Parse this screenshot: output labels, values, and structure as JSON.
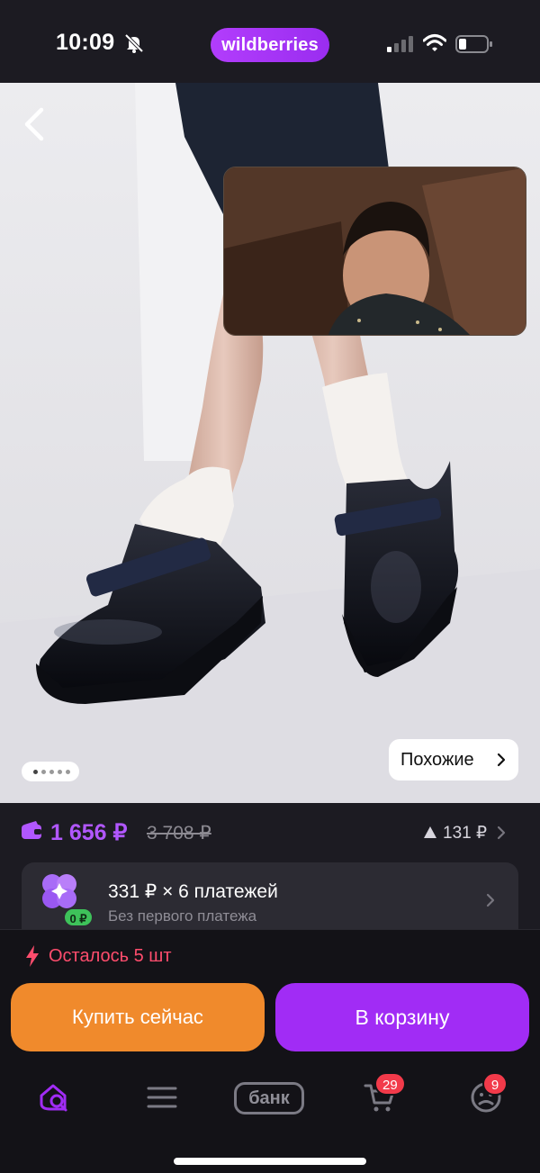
{
  "status_bar": {
    "time": "10:09",
    "brand": "wildberries"
  },
  "product_photo": {
    "gallery_dots": 5,
    "active_dot": 1,
    "similar_label": "Похожие"
  },
  "price": {
    "current": "1 656 ₽",
    "old": "3 708 ₽",
    "delta": "131 ₽"
  },
  "installment": {
    "title": "331 ₽ × 6 платежей",
    "subtitle": "Без первого платежа",
    "badge": "0 ₽"
  },
  "stock": {
    "text": "Осталось 5 шт"
  },
  "actions": {
    "buy_now": "Купить сейчас",
    "add_to_cart": "В корзину"
  },
  "tabbar": {
    "bank_label": "банк",
    "cart_badge": "29",
    "profile_badge": "9",
    "active_tab": "home",
    "colors": {
      "accent": "#a12cf5",
      "inactive": "#7b7a84"
    }
  },
  "colors": {
    "brand": "#b23dfc",
    "price": "#b157ff",
    "buy_now": "#f08a2c",
    "stock_warning": "#ff4d6d"
  }
}
